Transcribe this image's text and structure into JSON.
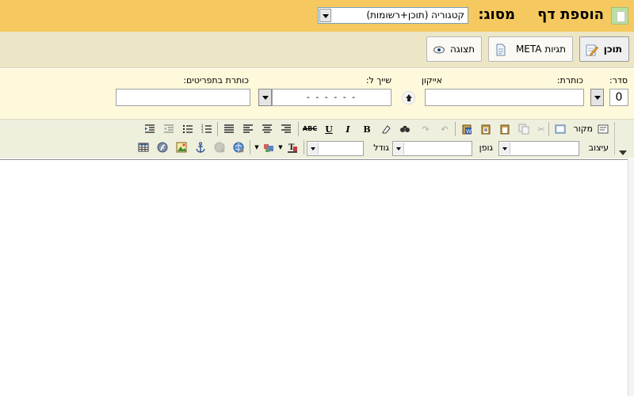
{
  "header": {
    "page_title": "הוספת דף",
    "type_label": "מסוג:",
    "type_select_value": "קטגוריה (תוכן+רשומות)"
  },
  "tabs": [
    {
      "label": "תוכן",
      "icon": "edit-icon",
      "active": true
    },
    {
      "label": "תגיות META",
      "icon": "document-icon",
      "active": false
    },
    {
      "label": "תצוגה",
      "icon": "eye-icon",
      "active": false
    }
  ],
  "form": {
    "order_label": "סדר:",
    "order_value": "0",
    "title_label": "כותרת:",
    "title_value": "",
    "icon_label": "אייקון",
    "parent_label": "שייך ל:",
    "parent_value": "- - - - - -",
    "pages_title_label": "כותרת בתפריטים:",
    "pages_title_value": ""
  },
  "toolbar": {
    "source_label": "מקור",
    "format_label": "עיצוב",
    "font_label": "גופן",
    "size_label": "גודל",
    "format_value": "",
    "font_value": "",
    "size_value": ""
  },
  "editor": {
    "content": ""
  },
  "colors": {
    "title_bar": "#f5c95f",
    "tabs_bar": "#ece6c6",
    "form_bar": "#fff9db",
    "toolbar_bg": "#efefde"
  }
}
